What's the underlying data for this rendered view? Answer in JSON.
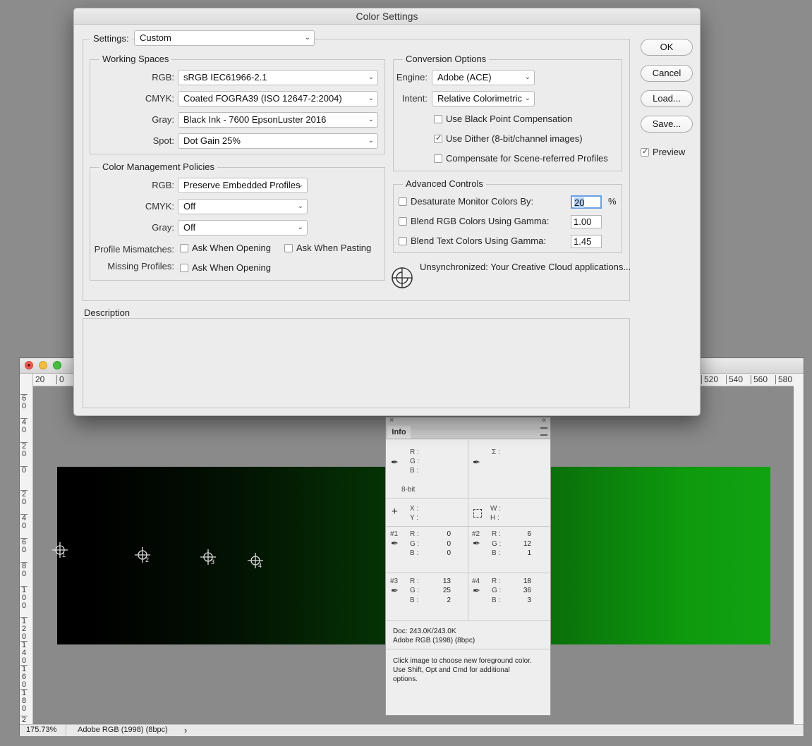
{
  "document_window": {
    "h_ruler_ticks": [
      "20",
      "0",
      "520",
      "540",
      "560",
      "580"
    ],
    "v_ruler_ticks": [
      "6\n0",
      "4\n0",
      "2\n0",
      "0",
      "2\n0",
      "4\n0",
      "6\n0",
      "8\n0",
      "1\n0\n0",
      "1\n2\n0",
      "1\n4\n0",
      "1\n6\n0",
      "1\n8\n0",
      "2"
    ],
    "status": {
      "zoom": "175.73%",
      "profile": "Adobe RGB (1998) (8bpc)",
      "arrow": "›"
    },
    "samplers": [
      "1",
      "2",
      "3",
      "4"
    ],
    "gradient_colors": {
      "start": "#000000",
      "end": "#11a211"
    }
  },
  "dialog": {
    "title": "Color Settings",
    "settings": {
      "label": "Settings:",
      "value": "Custom"
    },
    "working_spaces": {
      "legend": "Working Spaces",
      "rgb": {
        "label": "RGB:",
        "value": "sRGB IEC61966-2.1"
      },
      "cmyk": {
        "label": "CMYK:",
        "value": "Coated FOGRA39 (ISO 12647-2:2004)"
      },
      "gray": {
        "label": "Gray:",
        "value": "Black Ink - 7600 EpsonLuster 2016"
      },
      "spot": {
        "label": "Spot:",
        "value": "Dot Gain 25%"
      }
    },
    "policies": {
      "legend": "Color Management Policies",
      "rgb": {
        "label": "RGB:",
        "value": "Preserve Embedded Profiles"
      },
      "cmyk": {
        "label": "CMYK:",
        "value": "Off"
      },
      "gray": {
        "label": "Gray:",
        "value": "Off"
      },
      "mismatches_label": "Profile Mismatches:",
      "ask_opening": "Ask When Opening",
      "ask_pasting": "Ask When Pasting",
      "missing_label": "Missing Profiles:",
      "missing_ask_opening": "Ask When Opening"
    },
    "conversion": {
      "legend": "Conversion Options",
      "engine": {
        "label": "Engine:",
        "value": "Adobe (ACE)"
      },
      "intent": {
        "label": "Intent:",
        "value": "Relative Colorimetric"
      },
      "black_point": {
        "label": "Use Black Point Compensation",
        "checked": false
      },
      "dither": {
        "label": "Use Dither (8-bit/channel images)",
        "checked": true
      },
      "scene": {
        "label": "Compensate for Scene-referred Profiles",
        "checked": false
      }
    },
    "advanced": {
      "legend": "Advanced Controls",
      "desaturate": {
        "label": "Desaturate Monitor Colors By:",
        "value": "20",
        "unit": "%"
      },
      "blend_rgb": {
        "label": "Blend RGB Colors Using Gamma:",
        "value": "1.00"
      },
      "blend_text": {
        "label": "Blend Text Colors Using Gamma:",
        "value": "1.45"
      }
    },
    "sync_text": "Unsynchronized: Your Creative Cloud applications...",
    "description_legend": "Description",
    "buttons": {
      "ok": "OK",
      "cancel": "Cancel",
      "load": "Load...",
      "save": "Save..."
    },
    "preview": {
      "label": "Preview",
      "checked": true
    }
  },
  "info_panel": {
    "tab": "Info",
    "r": "R :",
    "g": "G :",
    "b": "B :",
    "sigma": "Σ :",
    "bitdepth": "8-bit",
    "x": "X :",
    "y": "Y :",
    "w": "W :",
    "h": "H :",
    "samplers": [
      {
        "id": "#1",
        "r": "0",
        "g": "0",
        "b": "0"
      },
      {
        "id": "#2",
        "r": "6",
        "g": "12",
        "b": "1"
      },
      {
        "id": "#3",
        "r": "13",
        "g": "25",
        "b": "2"
      },
      {
        "id": "#4",
        "r": "18",
        "g": "36",
        "b": "3"
      }
    ],
    "doc": "Doc: 243.0K/243.0K",
    "profile": "Adobe RGB (1998) (8bpc)",
    "hint": "Click image to choose new foreground color.  Use Shift, Opt and Cmd for additional options."
  }
}
